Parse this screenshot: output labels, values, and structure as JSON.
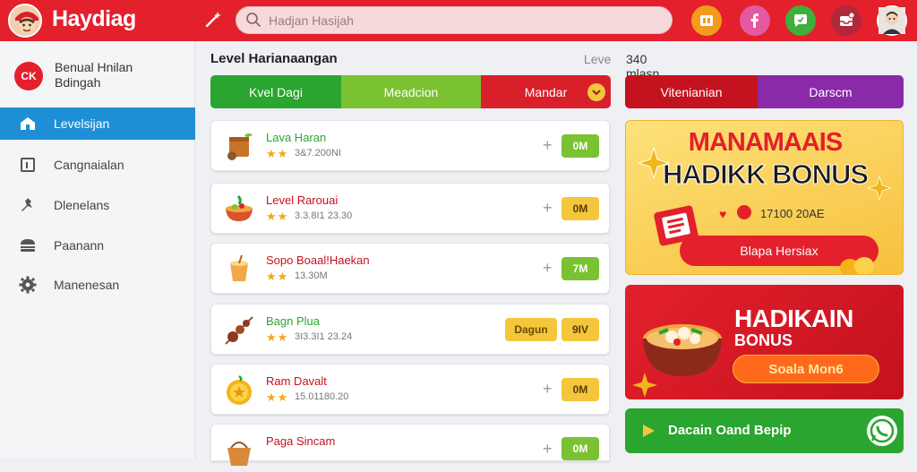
{
  "app": {
    "name": "Haydiag"
  },
  "search": {
    "placeholder": "Hadjan Hasijah"
  },
  "sidebar": {
    "profile": {
      "initials": "CK",
      "name": "Benual Hnilan Bdingah"
    },
    "items": [
      {
        "label": "Levelsijan",
        "icon": "home-icon",
        "active": true
      },
      {
        "label": "Cangnaialan",
        "icon": "book-icon",
        "active": false
      },
      {
        "label": "Dlenelans",
        "icon": "pin-icon",
        "active": false
      },
      {
        "label": "Paanann",
        "icon": "burger-icon",
        "active": false
      },
      {
        "label": "Manenesan",
        "icon": "gear-icon",
        "active": false
      }
    ]
  },
  "main": {
    "title": "Level Harianaangan",
    "meta_label": "Leve",
    "meta_value": "340 mlasn",
    "tabs": [
      {
        "label": "Kvel Dagi",
        "color": "#2aa52f"
      },
      {
        "label": "Meadcion",
        "color": "#7ac232"
      },
      {
        "label": "Mandar",
        "color": "#d81f2a"
      }
    ],
    "items": [
      {
        "name": "Lava Haran",
        "name_color": "#2aa52f",
        "meta": "3&7.200NI",
        "price": "0M",
        "price_bg": "#7ac232",
        "price_color": "#fff",
        "extra": "",
        "food": "crate-icon"
      },
      {
        "name": "Level Rarouai",
        "name_color": "#c4121e",
        "meta": "3.3.8I1 23.30",
        "price": "0M",
        "price_bg": "#f4c63c",
        "price_color": "#5a3d00",
        "extra": "",
        "food": "bowl-icon"
      },
      {
        "name": "Sopo Boaal!Haekan",
        "name_color": "#c4121e",
        "meta": "13.30M",
        "price": "7M",
        "price_bg": "#7ac232",
        "price_color": "#fff",
        "extra": "",
        "food": "cup-icon"
      },
      {
        "name": "Bagn Plua",
        "name_color": "#2aa52f",
        "meta": "3I3.3I1 23.24",
        "price": "9IV",
        "price_bg": "#f4c63c",
        "price_color": "#5a3d00",
        "extra": "Dagun",
        "food": "meat-icon"
      },
      {
        "name": "Ram Davalt",
        "name_color": "#c4121e",
        "meta": "15.01180.20",
        "price": "0M",
        "price_bg": "#f4c63c",
        "price_color": "#5a3d00",
        "extra": "",
        "food": "coin-icon"
      },
      {
        "name": "Paga Sincam",
        "name_color": "#c4121e",
        "meta": "",
        "price": "0M",
        "price_bg": "#7ac232",
        "price_color": "#fff",
        "extra": "",
        "food": "basket-icon"
      }
    ]
  },
  "right": {
    "tabs": [
      {
        "label": "Vitenianian",
        "color": "#c4121e"
      },
      {
        "label": "Darscm",
        "color": "#8a2aa8"
      }
    ],
    "promo1": {
      "title": "MANAMAAIS",
      "subtitle": "HADIKK BONUS",
      "date": "17100 20AE",
      "button": "Blapa Hersiax"
    },
    "promo2": {
      "title": "HADIKAIN",
      "subtitle": "BONUS",
      "button": "Soala Mon6"
    },
    "play_button": "Dacain Oand Bepip"
  },
  "colors": {
    "brand": "#e3202c",
    "accent_blue": "#1e8fd6",
    "green": "#2aa52f"
  }
}
